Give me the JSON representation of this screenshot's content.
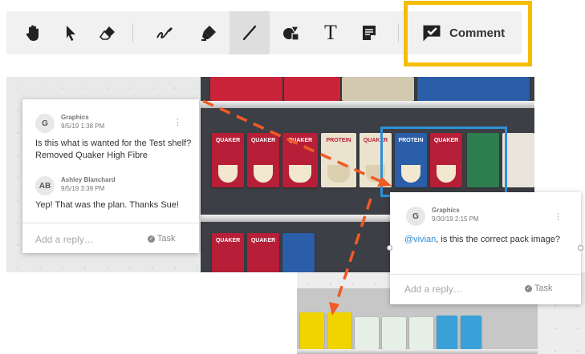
{
  "toolbar": {
    "tools": [
      {
        "name": "pan-hand-icon"
      },
      {
        "name": "select-arrow-icon"
      },
      {
        "name": "eraser-icon"
      },
      {
        "name": "freehand-pen-icon"
      },
      {
        "name": "highlighter-icon"
      },
      {
        "name": "line-icon",
        "active": true
      },
      {
        "name": "shapes-icon"
      },
      {
        "name": "text-icon",
        "glyph": "T"
      },
      {
        "name": "note-icon"
      }
    ],
    "comment_label": "Comment",
    "accent_color": "#f5bd00"
  },
  "scene": {
    "brand": "QUAKER",
    "pack_labels": [
      "PROTEIN",
      "PROTEIN"
    ]
  },
  "comments": [
    {
      "avatar": "G",
      "author": "Graphics",
      "time": "9/5/19 1:38 PM",
      "message": "Is this what is wanted for the Test shelf?  Removed Quaker High Fibre",
      "reply": {
        "avatar": "AB",
        "author": "Ashley Blanchard",
        "time": "9/5/19 3:39 PM",
        "message": "Yep! That was the plan.  Thanks Sue!"
      },
      "reply_placeholder": "Add a reply…",
      "task_label": "Task"
    },
    {
      "avatar": "G",
      "author": "Graphics",
      "time": "9/30/19 2:15 PM",
      "mention": "@vivian",
      "message": ", is this the correct pack image?",
      "reply_placeholder": "Add a reply…",
      "task_label": "Task"
    }
  ],
  "colors": {
    "arrow": "#f15a24",
    "selection": "#2f8fd8",
    "mention": "#2e8bd6"
  }
}
